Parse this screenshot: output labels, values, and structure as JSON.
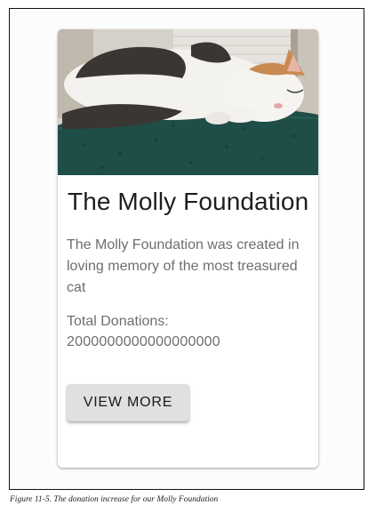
{
  "card": {
    "image_alt": "Sleeping calico cat on a green carpeted cat tree",
    "title": "The Molly Foundation",
    "description": "The Molly Foundation was created in loving memory of the most treasured cat",
    "donations_label": "Total Donations:",
    "donations_value": "2000000000000000000",
    "button_label": "VIEW MORE"
  },
  "caption": "Figure 11-5. The donation increase for our Molly Foundation",
  "colors": {
    "title": "#1f1f1f",
    "body_text": "#6e6e6e",
    "button_bg": "#e0e0e0",
    "carpet": "#1f4d47"
  }
}
